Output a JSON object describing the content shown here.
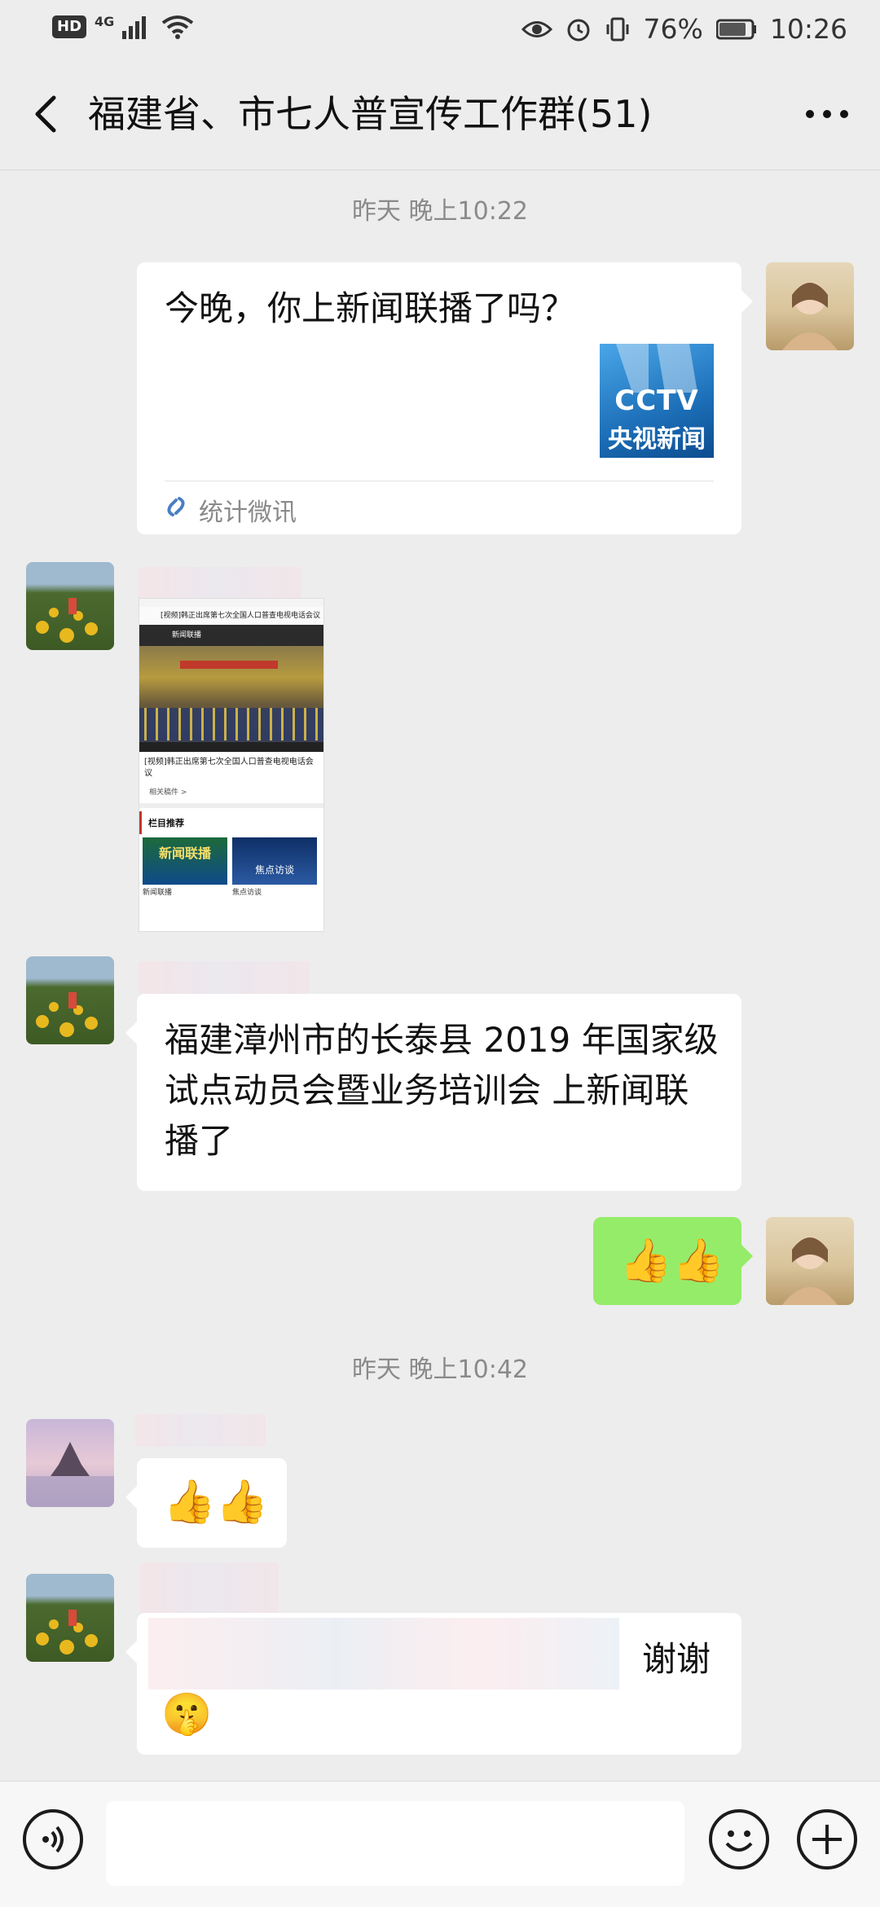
{
  "status_bar": {
    "hd": "HD",
    "network": "4G",
    "battery": "76%",
    "time": "10:26"
  },
  "header": {
    "title": "福建省、市七人普宣传工作群(51)"
  },
  "timestamps": [
    "昨天 晚上10:22",
    "昨天 晚上10:42"
  ],
  "messages": {
    "m1": {
      "text": "今晚，你上新闻联播了吗？",
      "source": "统计微讯",
      "thumb_top": "CCTV",
      "thumb_bottom": "央视新闻"
    },
    "m2": {
      "shot_title": "[视频]韩正出席第七次全国人口普查电视电话会议",
      "shot_related": "相关稿件 >",
      "shot_section": "栏目推荐",
      "shot_tile1": "新闻联播",
      "shot_tile1_label": "新闻联播",
      "shot_tile2": "焦点访谈",
      "shot_tile2_label": "焦点访谈",
      "shot_app": "新闻联播"
    },
    "m3": {
      "text": "福建漳州市的长泰县 2019 年国家级试点动员会暨业务培训会  上新闻联播了"
    },
    "m4": {
      "text": "👍👍"
    },
    "m5": {
      "text": "👍👍"
    },
    "m6": {
      "text": "谢谢",
      "emoji": "🤫"
    }
  },
  "colors": {
    "background": "#ededed",
    "bubble_in": "#ffffff",
    "bubble_out_green": "#95ec69",
    "timestamp": "#8a8a8a"
  },
  "icons": [
    "back-arrow-icon",
    "more-icon",
    "voice-icon",
    "emoji-icon",
    "plus-icon",
    "link-icon"
  ]
}
